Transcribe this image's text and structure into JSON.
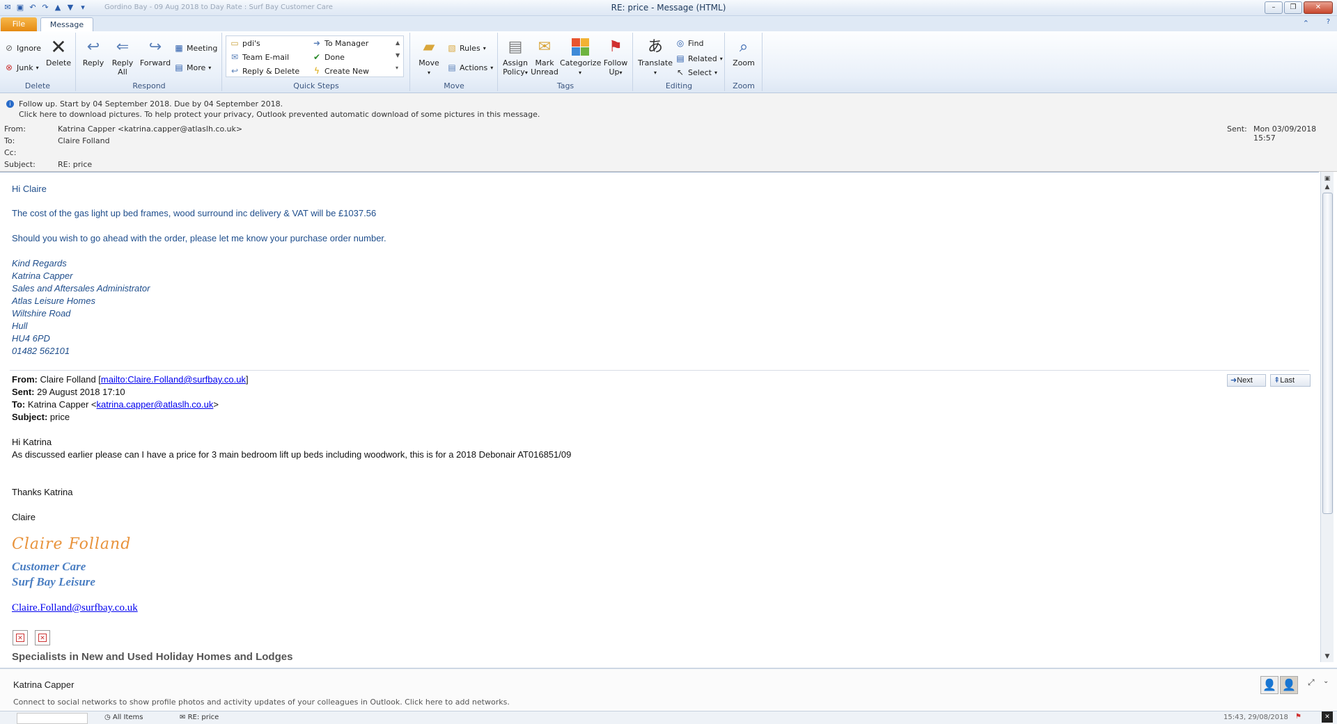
{
  "window": {
    "title": "RE: price  -  Message (HTML)",
    "qat_icons": [
      "outlook-icon",
      "save-icon",
      "undo-icon",
      "redo-icon",
      "up-arrow-icon",
      "down-arrow-icon",
      "customize-icon"
    ],
    "qat_faded_text": "Gordino Bay - 09 Aug 2018 to Day Rate : Surf Bay Customer Care"
  },
  "tabs": {
    "file": "File",
    "message": "Message"
  },
  "ribbon": {
    "delete_group": {
      "label": "Delete",
      "ignore": "Ignore",
      "junk": "Junk",
      "delete": "Delete"
    },
    "respond_group": {
      "label": "Respond",
      "reply": "Reply",
      "reply_all_1": "Reply",
      "reply_all_2": "All",
      "forward": "Forward",
      "meeting": "Meeting",
      "more": "More"
    },
    "quicksteps_group": {
      "label": "Quick Steps",
      "items": [
        "pdi's",
        "To Manager",
        "Team E-mail",
        "Done",
        "Reply & Delete",
        "Create New"
      ]
    },
    "move_group": {
      "label": "Move",
      "move": "Move",
      "rules": "Rules",
      "actions": "Actions"
    },
    "tags_group": {
      "label": "Tags",
      "assign_1": "Assign",
      "assign_2": "Policy",
      "mark_1": "Mark",
      "mark_2": "Unread",
      "categorize": "Categorize",
      "follow_1": "Follow",
      "follow_2": "Up"
    },
    "editing_group": {
      "label": "Editing",
      "translate": "Translate",
      "find": "Find",
      "related": "Related",
      "select": "Select"
    },
    "zoom_group": {
      "label": "Zoom",
      "zoom": "Zoom"
    }
  },
  "infobar": {
    "line1": "Follow up.  Start by 04 September 2018.  Due by 04 September 2018.",
    "line2": "Click here to download pictures. To help protect your privacy, Outlook prevented automatic download of some pictures in this message."
  },
  "headers": {
    "from_label": "From:",
    "from_value": "Katrina Capper <katrina.capper@atlaslh.co.uk>",
    "to_label": "To:",
    "to_value": "Claire Folland",
    "cc_label": "Cc:",
    "cc_value": "",
    "subject_label": "Subject:",
    "subject_value": "RE: price",
    "sent_label": "Sent:",
    "sent_value": "Mon 03/09/2018 15:57"
  },
  "body": {
    "greeting": "Hi Claire",
    "para1": "The cost of the gas light up bed frames, wood surround inc delivery & VAT will be £1037.56",
    "para2": "Should you wish to go ahead with the order, please let me know your purchase order number.",
    "signature": [
      "Kind Regards",
      "Katrina Capper",
      "Sales and Aftersales Administrator",
      "Atlas Leisure Homes",
      "Wiltshire Road",
      "Hull",
      "HU4 6PD",
      "01482 562101"
    ],
    "quoted": {
      "from_label": "From:",
      "from_name": "Claire Folland [",
      "from_link": "mailto:Claire.Folland@surfbay.co.uk",
      "from_end": "]",
      "sent_label": "Sent:",
      "sent_value": "29 August 2018 17:10",
      "to_label": "To:",
      "to_name": "Katrina Capper <",
      "to_link": "katrina.capper@atlaslh.co.uk",
      "to_end": ">",
      "subject_label": "Subject:",
      "subject_value": "price",
      "greeting": "Hi Katrina",
      "line1": "As discussed earlier please can I have a price for 3 main bedroom lift up beds including woodwork, this is for a 2018 Debonair AT016851/09",
      "thanks": "Thanks Katrina",
      "name": "Claire",
      "sig_script": "Claire Folland",
      "sig_role": "Customer Care",
      "sig_company": "Surf Bay Leisure",
      "sig_email": "Claire.Folland@surfbay.co.uk",
      "tagline": "Specialists in New and Used Holiday Homes and Lodges"
    },
    "nav": {
      "next": "Next",
      "last": "Last"
    }
  },
  "people_pane": {
    "name": "Katrina Capper",
    "connect_text": "Connect to social networks to show profile photos and activity updates of your colleagues in Outlook. Click here to add networks."
  },
  "statusbar": {
    "all_items": "All Items",
    "item": "RE: price",
    "time": "15:43, 29/08/2018"
  },
  "colors": {
    "body_text_blue": "#1f4e8c",
    "sig_orange": "#e8923a",
    "sig_blue": "#4a7ec2",
    "file_tab": "#e58a12"
  }
}
